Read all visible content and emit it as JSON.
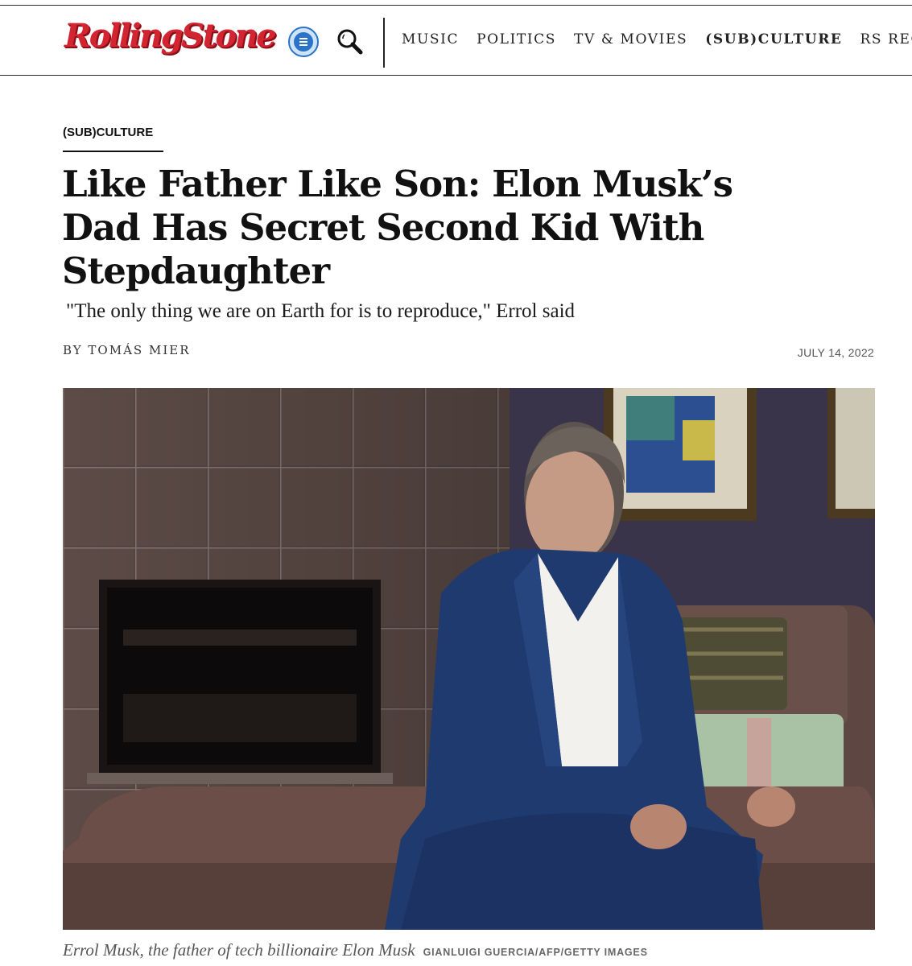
{
  "site": {
    "logo": "RollingStone",
    "brand_color": "#d32531",
    "icons": {
      "menu": "menu-icon",
      "search": "search-icon"
    }
  },
  "nav": {
    "items": [
      {
        "label": "MUSIC",
        "active": false
      },
      {
        "label": "POLITICS",
        "active": false
      },
      {
        "label": "TV & MOVIES",
        "active": false
      },
      {
        "label": "(SUB)CULTURE",
        "active": true
      },
      {
        "label": "RS RECOMMENDS",
        "active": false
      }
    ]
  },
  "article": {
    "category": "(SUB)CULTURE",
    "headline": "Like Father Like Son: Elon Musk’s Dad Has Secret Second Kid With Stepdaughter",
    "dek": "\"The only thing we are on Earth for is to reproduce,\" Errol said",
    "byline": "BY TOMÁS MIER",
    "date": "JULY 14, 2022"
  },
  "photo": {
    "caption": "Errol Musk, the father of tech billionaire Elon Musk",
    "credit": "GIANLUIGI GUERCIA/AFP/GETTY IMAGES"
  }
}
